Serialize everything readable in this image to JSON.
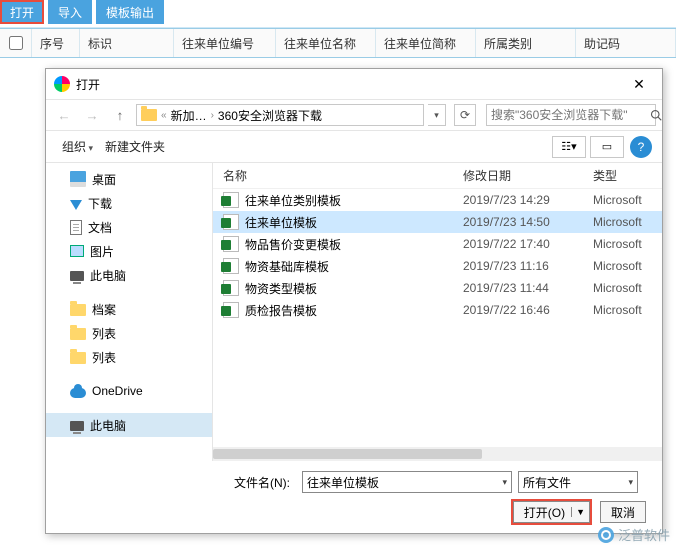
{
  "toolbar": {
    "open": "打开",
    "import": "导入",
    "export_tpl": "模板输出"
  },
  "grid_headers": [
    "序号",
    "标识",
    "往来单位编号",
    "往来单位名称",
    "往来单位简称",
    "所属类别",
    "助记码"
  ],
  "dialog": {
    "title": "打开",
    "breadcrumbs": [
      "新加…",
      "360安全浏览器下载"
    ],
    "search_placeholder": "搜索\"360安全浏览器下载\"",
    "organize": "组织",
    "new_folder": "新建文件夹",
    "view_icon_label": "☷",
    "preview_icon_label": "▭",
    "columns": {
      "name": "名称",
      "modified": "修改日期",
      "type": "类型"
    },
    "filename_label": "文件名(N):",
    "filename_value": "往来单位模板",
    "filetype_value": "所有文件",
    "open_btn": "打开(O)",
    "cancel_btn": "取消"
  },
  "sidebar": [
    {
      "label": "桌面",
      "icon": "desktop"
    },
    {
      "label": "下载",
      "icon": "download"
    },
    {
      "label": "文档",
      "icon": "doc"
    },
    {
      "label": "图片",
      "icon": "pic"
    },
    {
      "label": "此电脑",
      "icon": "pc"
    },
    {
      "label": "档案",
      "icon": "folder"
    },
    {
      "label": "列表",
      "icon": "folder"
    },
    {
      "label": "列表",
      "icon": "folder"
    },
    {
      "label": "OneDrive",
      "icon": "cloud"
    },
    {
      "label": "此电脑",
      "icon": "pc",
      "selected": true
    }
  ],
  "files": [
    {
      "name": "往来单位类别模板",
      "date": "2019/7/23 14:29",
      "type": "Microsoft"
    },
    {
      "name": "往来单位模板",
      "date": "2019/7/23 14:50",
      "type": "Microsoft",
      "selected": true
    },
    {
      "name": "物品售价变更模板",
      "date": "2019/7/22 17:40",
      "type": "Microsoft"
    },
    {
      "name": "物资基础库模板",
      "date": "2019/7/23 11:16",
      "type": "Microsoft"
    },
    {
      "name": "物资类型模板",
      "date": "2019/7/23 11:44",
      "type": "Microsoft"
    },
    {
      "name": "质检报告模板",
      "date": "2019/7/22 16:46",
      "type": "Microsoft"
    }
  ],
  "watermark": "泛普软件"
}
